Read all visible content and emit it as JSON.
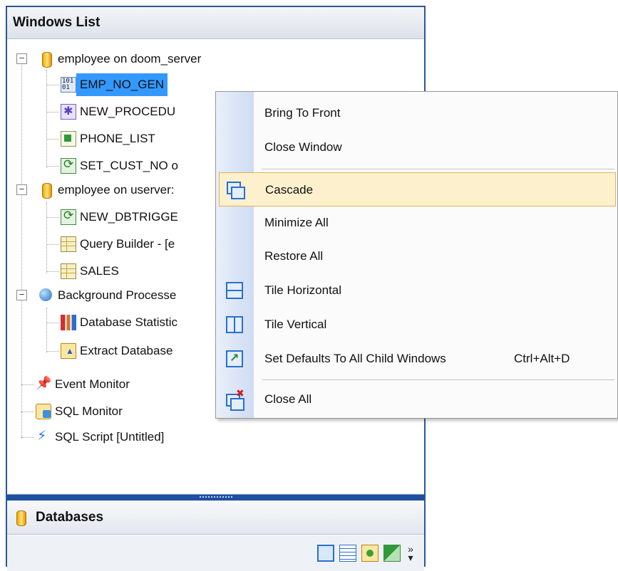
{
  "panel": {
    "title": "Windows List",
    "tree": [
      {
        "label": "employee on doom_server",
        "icon": "database-icon"
      },
      {
        "label": "EMP_NO_GEN",
        "icon": "generator-icon",
        "selected": true
      },
      {
        "label": "NEW_PROCEDU",
        "icon": "procedure-icon"
      },
      {
        "label": "PHONE_LIST",
        "icon": "view-icon"
      },
      {
        "label": "SET_CUST_NO o",
        "icon": "trigger-icon"
      },
      {
        "label": "employee on userver:",
        "icon": "database-icon"
      },
      {
        "label": "NEW_DBTRIGGE",
        "icon": "dbtrigger-icon"
      },
      {
        "label": "Query Builder - [e",
        "icon": "table-icon"
      },
      {
        "label": "SALES",
        "icon": "table-icon"
      },
      {
        "label": "Background Processe",
        "icon": "background-process-icon"
      },
      {
        "label": "Database Statistic",
        "icon": "statistics-icon"
      },
      {
        "label": "Extract Database",
        "icon": "extract-icon"
      },
      {
        "label": "Event Monitor",
        "icon": "pin-icon"
      },
      {
        "label": "SQL Monitor",
        "icon": "monitor-icon"
      },
      {
        "label": "SQL Script [Untitled]",
        "icon": "script-icon"
      }
    ],
    "databases_title": "Databases"
  },
  "menu": {
    "items": [
      {
        "label": "Bring To Front"
      },
      {
        "label": "Close Window"
      },
      {
        "label": "Cascade",
        "highlighted": true,
        "icon": "cascade-icon"
      },
      {
        "label": "Minimize All"
      },
      {
        "label": "Restore All"
      },
      {
        "label": "Tile Horizontal",
        "icon": "tile-horizontal-icon"
      },
      {
        "label": "Tile Vertical",
        "icon": "tile-vertical-icon"
      },
      {
        "label": "Set Defaults To All Child Windows",
        "shortcut": "Ctrl+Alt+D",
        "icon": "set-defaults-icon"
      },
      {
        "label": "Close All",
        "icon": "close-all-icon"
      }
    ]
  },
  "colors": {
    "selection": "#3399ff",
    "menu_highlight": "#fdf1cd",
    "panel_border": "#2b579a"
  }
}
